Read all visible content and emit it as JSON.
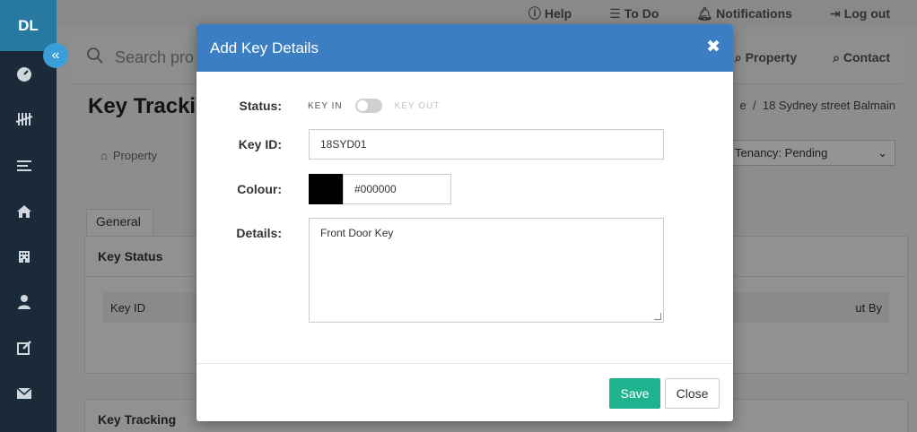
{
  "sidebar": {
    "brand": "DL",
    "collapse_icon": "«",
    "icons": [
      "gauge-icon",
      "tally-icon",
      "list-icon",
      "home-icon",
      "building-icon",
      "user-icon",
      "edit-icon",
      "mail-icon"
    ]
  },
  "topbar": {
    "help": "Help",
    "todo": "To Do",
    "notifications": "Notifications",
    "logout": "Log out"
  },
  "search": {
    "placeholder": "Search pro",
    "property": "Property",
    "contact": "Contact"
  },
  "page": {
    "title": "Key Tracki",
    "breadcrumb_partial": "e",
    "breadcrumb_sep": "/",
    "breadcrumb_current": "18 Sydney street Balmain",
    "property_tab": "Property",
    "tenancy_select": "Tenancy: Pending",
    "general_tab": "General",
    "key_status_title": "Key Status",
    "col_key_id": "Key ID",
    "col_out_by": "ut By",
    "key_tracking_title": "Key Tracking"
  },
  "modal": {
    "title": "Add Key Details",
    "close_icon": "✖",
    "status_label": "Status:",
    "key_in": "KEY IN",
    "key_out": "KEY OUT",
    "key_id_label": "Key ID:",
    "key_id_value": "18SYD01",
    "colour_label": "Colour:",
    "colour_value": "#000000",
    "details_label": "Details:",
    "details_value": "Front Door Key",
    "save": "Save",
    "close": "Close"
  }
}
